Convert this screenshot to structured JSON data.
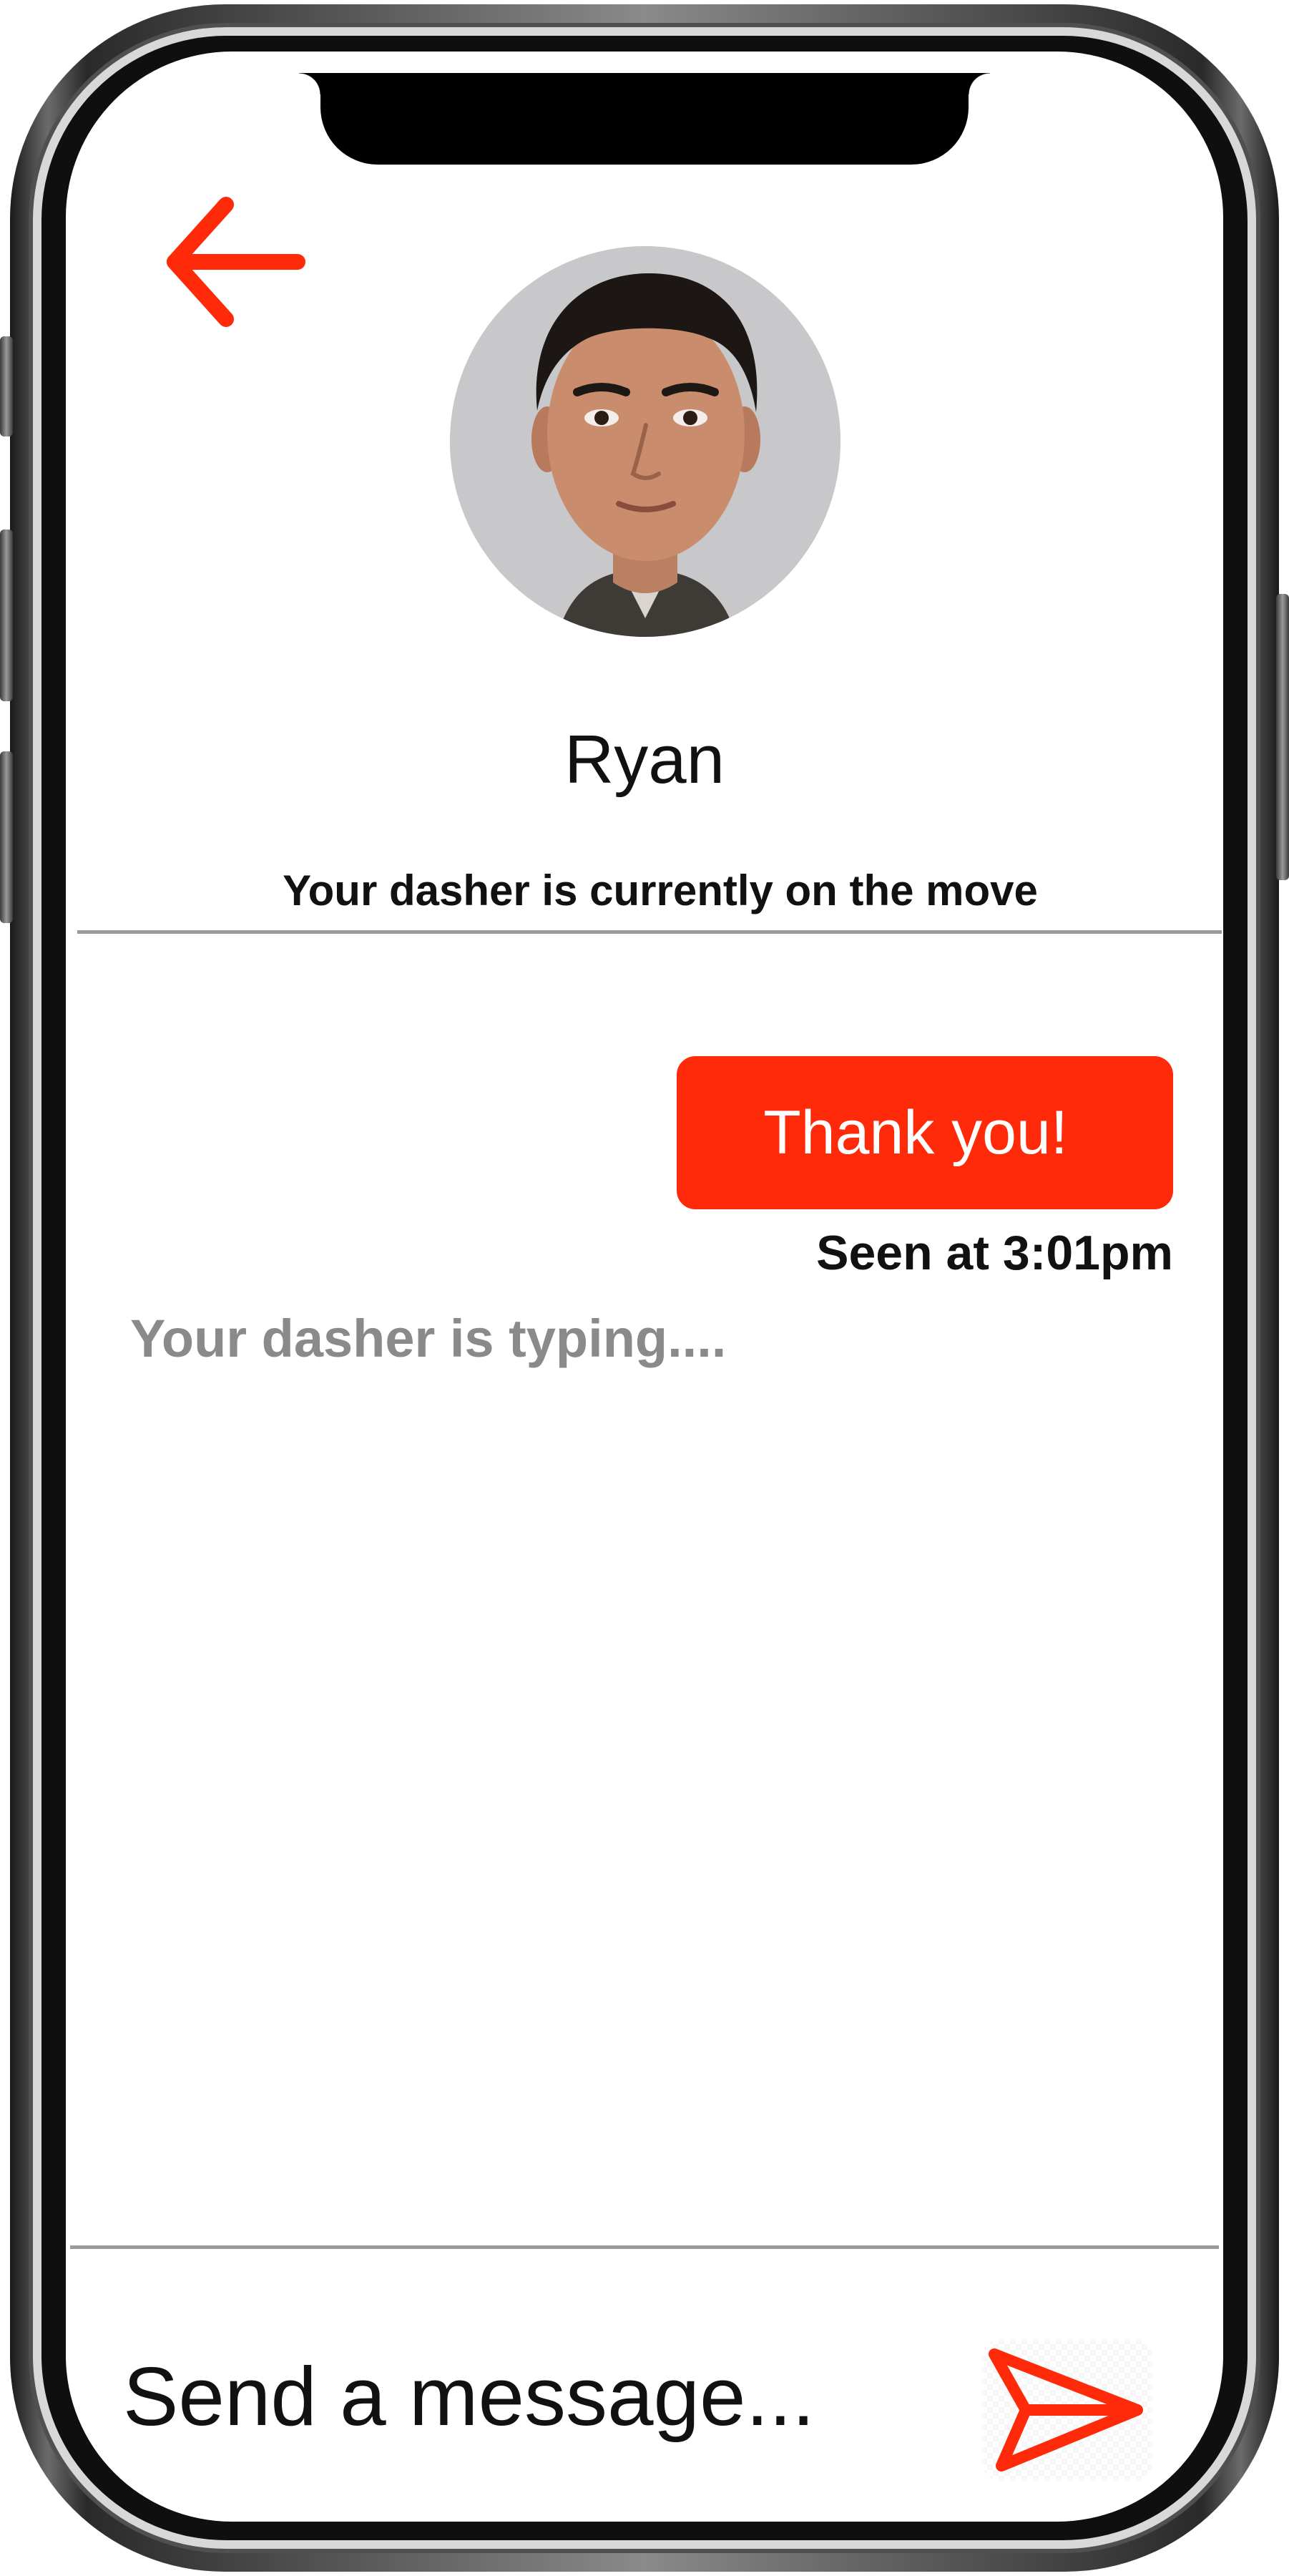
{
  "header": {
    "back_icon": "arrow-left-icon",
    "contact_name": "Ryan",
    "status_text": "Your dasher is currently on the move"
  },
  "conversation": {
    "messages": [
      {
        "sender": "me",
        "text": "Thank you!",
        "receipt": "Seen at 3:01pm"
      }
    ],
    "typing_indicator": "Your dasher is typing...."
  },
  "composer": {
    "placeholder": "Send a message...",
    "value": "",
    "send_icon": "paper-plane-icon"
  },
  "colors": {
    "accent": "#ff2a0a",
    "muted_text": "#8a8a8a",
    "text": "#111111",
    "divider": "#9a9a9a"
  }
}
